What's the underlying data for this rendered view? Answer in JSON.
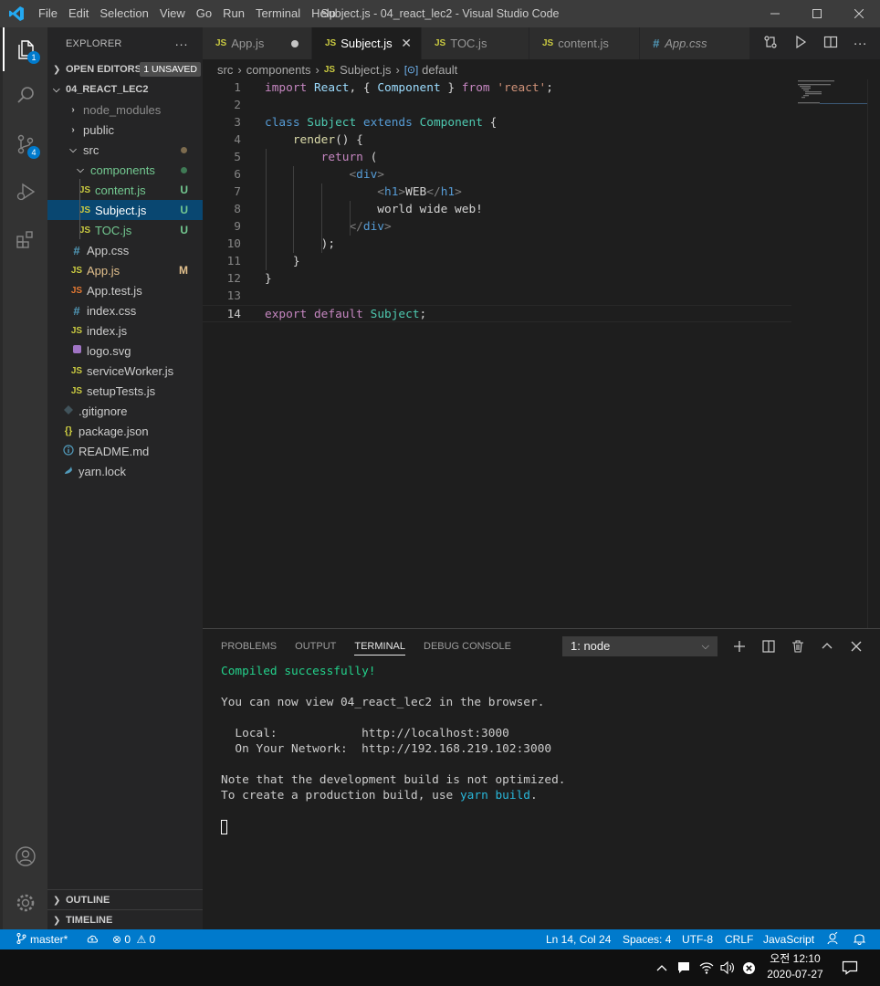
{
  "titlebar": {
    "menu": [
      "File",
      "Edit",
      "Selection",
      "View",
      "Go",
      "Run",
      "Terminal",
      "Help"
    ],
    "title": "Subject.js - 04_react_lec2 - Visual Studio Code"
  },
  "activitybar": {
    "explorer_badge": "1",
    "scm_badge": "4"
  },
  "sidebar": {
    "header": "EXPLORER",
    "open_editors": "OPEN EDITORS",
    "unsaved_badge": "1 UNSAVED",
    "project": "04_REACT_LEC2",
    "tree": {
      "node_modules": "node_modules",
      "public": "public",
      "src": "src",
      "components": "components",
      "content_js": "content.js",
      "content_status": "U",
      "subject_js": "Subject.js",
      "subject_status": "U",
      "toc_js": "TOC.js",
      "toc_status": "U",
      "app_css": "App.css",
      "app_js": "App.js",
      "app_status": "M",
      "app_test": "App.test.js",
      "index_css": "index.css",
      "index_js": "index.js",
      "logo": "logo.svg",
      "service_worker": "serviceWorker.js",
      "setup_tests": "setupTests.js",
      "gitignore": ".gitignore",
      "package_json": "package.json",
      "readme": "README.md",
      "yarn_lock": "yarn.lock"
    },
    "outline": "OUTLINE",
    "timeline": "TIMELINE"
  },
  "tabs": [
    "App.js",
    "Subject.js",
    "TOC.js",
    "content.js",
    "App.css"
  ],
  "breadcrumb": {
    "folder1": "src",
    "folder2": "components",
    "file": "Subject.js",
    "symbol": "default"
  },
  "code": {
    "l1_import": "import",
    "l1_react": "React",
    "l1_comp": "Component",
    "l1_from": "from",
    "l1_str": "'react'",
    "l3_class": "class",
    "l3_subject": "Subject",
    "l3_extends": "extends",
    "l3_component": "Component",
    "l4_render": "render",
    "l5_return": "return",
    "l6_tag": "div",
    "l7_tag": "h1",
    "l7_text": "WEB",
    "l8_text": "world wide web!",
    "l9_tag": "div",
    "l14_export": "export",
    "l14_default": "default",
    "l14_subject": "Subject"
  },
  "panel": {
    "tabs": [
      "PROBLEMS",
      "OUTPUT",
      "TERMINAL",
      "DEBUG CONSOLE"
    ],
    "terminal_select": "1: node",
    "terminal": {
      "line1": "Compiled successfully!",
      "line2": "You can now view 04_react_lec2 in the browser.",
      "line3": "  Local:            http://localhost:3000",
      "line4": "  On Your Network:  http://192.168.219.102:3000",
      "line5": "Note that the development build is not optimized.",
      "line6_pre": "To create a production build, use ",
      "line6_cmd": "yarn build",
      "line6_post": "."
    }
  },
  "statusbar": {
    "branch": "master*",
    "errors": "0",
    "warnings": "0",
    "position": "Ln 14, Col 24",
    "spaces": "Spaces: 4",
    "encoding": "UTF-8",
    "eol": "CRLF",
    "language": "JavaScript"
  },
  "taskbar": {
    "ime": "오전 12:10",
    "date": "2020-07-27"
  },
  "colors": {
    "accent": "#007acc",
    "untracked": "#73c991",
    "modified": "#e2c08d"
  }
}
